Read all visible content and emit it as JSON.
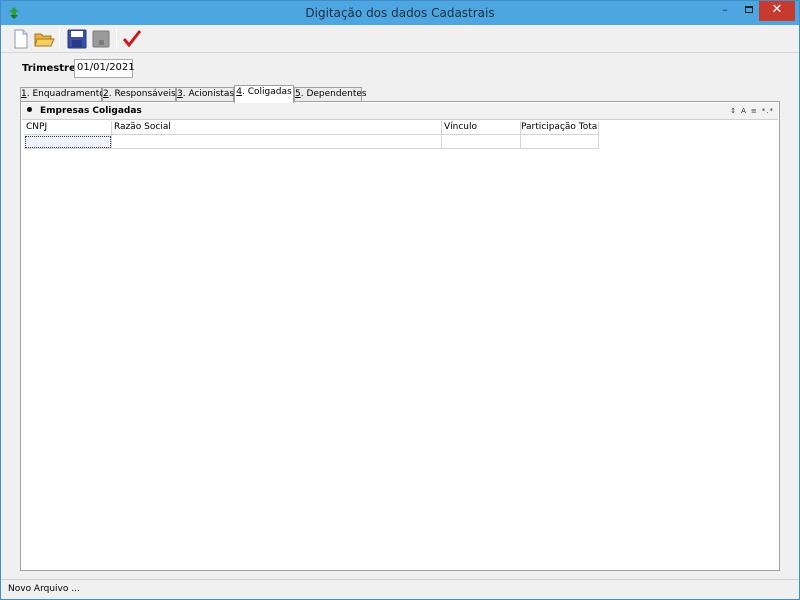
{
  "window": {
    "title": "Digitação dos dados Cadastrais",
    "minimize_glyph": "–",
    "close_glyph": "✕"
  },
  "toolbar": {
    "items": [
      "new-file-icon",
      "open-folder-icon",
      "save-icon",
      "save-disabled-icon",
      "confirm-check-icon"
    ],
    "accent_check": "#cc1a1a"
  },
  "form": {
    "trimestre_label": "Trimestre",
    "trimestre_value": "01/01/2021"
  },
  "tabs": [
    {
      "num": "1",
      "label": ". Enquadramento",
      "active": false
    },
    {
      "num": "2",
      "label": ". Responsáveis",
      "active": false
    },
    {
      "num": "3",
      "label": ". Acionistas",
      "active": false
    },
    {
      "num": "4",
      "label": ". Coligadas",
      "active": true
    },
    {
      "num": "5",
      "label": ". Dependentes",
      "active": false
    }
  ],
  "section": {
    "title": "Empresas Coligadas",
    "tools": [
      "↕",
      "A",
      "≡",
      "*.*"
    ]
  },
  "grid": {
    "columns": [
      "CNPJ",
      "Razão Social",
      "Vínculo",
      "Participação Total"
    ],
    "rows": [
      [
        "",
        "",
        "",
        ""
      ]
    ]
  },
  "status": {
    "text": "Novo Arquivo ..."
  }
}
